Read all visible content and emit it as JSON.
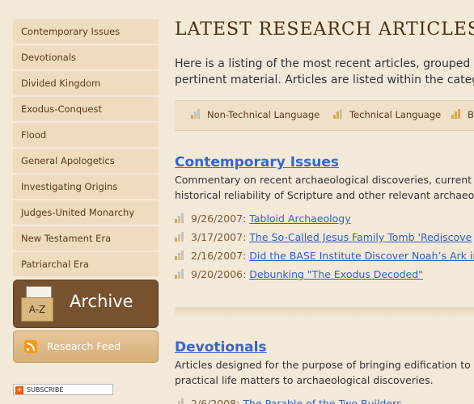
{
  "sidebar": {
    "items": [
      {
        "label": "Contemporary Issues"
      },
      {
        "label": "Devotionals"
      },
      {
        "label": "Divided Kingdom"
      },
      {
        "label": "Exodus-Conquest"
      },
      {
        "label": "Flood"
      },
      {
        "label": "General Apologetics"
      },
      {
        "label": "Investigating Origins"
      },
      {
        "label": "Judges-United Monarchy"
      },
      {
        "label": "New Testament Era"
      },
      {
        "label": "Patriarchal Era"
      }
    ],
    "archive": {
      "label": "Archive",
      "icon_text": "A-Z"
    },
    "feed": {
      "label": "Research Feed"
    },
    "subscribe": {
      "label": "SUBSCRIBE"
    }
  },
  "main": {
    "title": "LATEST RESEARCH ARTICLES BY CA",
    "intro_line1": "Here is a listing of the most recent articles, grouped",
    "intro_line2": "pertinent material. Articles are listed within the categ",
    "legend": [
      {
        "label": "Non-Technical Language"
      },
      {
        "label": "Technical Language"
      },
      {
        "label": "B"
      }
    ],
    "sections": [
      {
        "title": "Contemporary Issues",
        "desc_line1": "Commentary on recent archaeological discoveries, current",
        "desc_line2": "historical reliability of Scripture and other relevant archaeo",
        "articles": [
          {
            "date": "9/26/2007:",
            "title": "Tabloid Archaeology"
          },
          {
            "date": "3/17/2007:",
            "title": "The So-Called Jesus Family Tomb 'Rediscove"
          },
          {
            "date": "2/16/2007:",
            "title": "Did the BASE Institute Discover Noah’s Ark in"
          },
          {
            "date": "9/20/2006:",
            "title": "Debunking \"The Exodus Decoded\""
          }
        ]
      },
      {
        "title": "Devotionals",
        "desc_line1": "Articles designed for the purpose of bringing edification to t",
        "desc_line2": "practical life matters to archaeological discoveries.",
        "articles": [
          {
            "date": "2/6/2008:",
            "title": "The Parable of the Two Builders"
          }
        ]
      }
    ]
  },
  "colors": {
    "background": "#f3e9d9",
    "sidebar_item": "#efdcc0",
    "archive_bg": "#77522f",
    "link": "#2f5fc8",
    "title": "#4b2f16"
  }
}
